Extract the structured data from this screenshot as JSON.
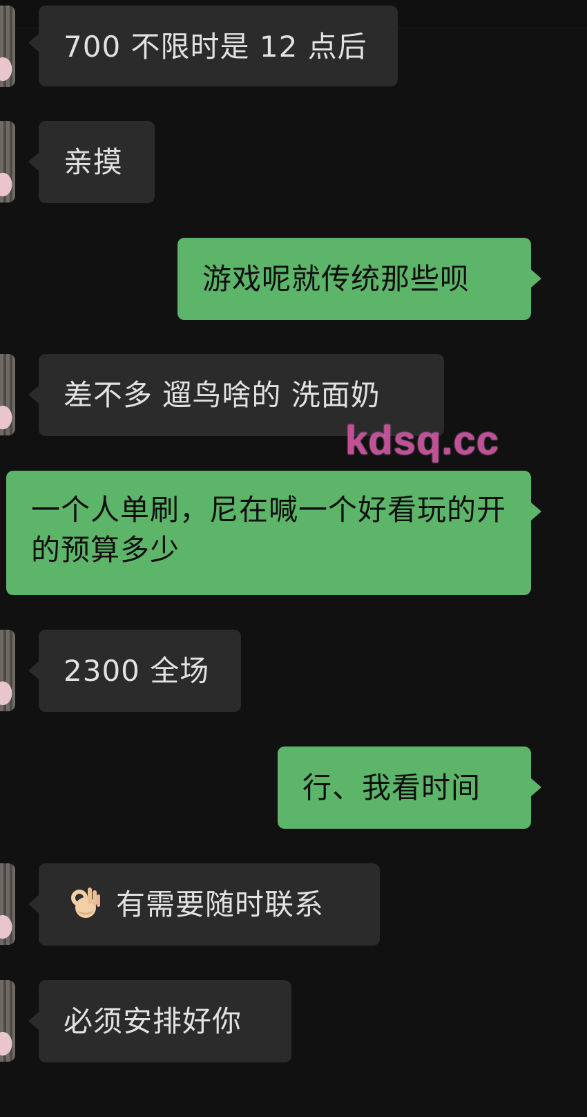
{
  "watermark": "kdsq.cc",
  "messages": [
    {
      "side": "in",
      "text": "700 不限时是 12 点后"
    },
    {
      "side": "in",
      "text": "亲摸"
    },
    {
      "side": "out",
      "text": "游戏呢就传统那些呗"
    },
    {
      "side": "in",
      "text": "差不多 遛鸟啥的 洗面奶"
    },
    {
      "side": "out",
      "text": "一个人单刷，尼在喊一个好看玩的开的预算多少"
    },
    {
      "side": "in",
      "text": "2300 全场"
    },
    {
      "side": "out",
      "text": "行、我看时间"
    },
    {
      "side": "in",
      "emoji": "ok-hand-emoji",
      "text": "有需要随时联系"
    },
    {
      "side": "in",
      "text": "必须安排好你"
    }
  ]
}
